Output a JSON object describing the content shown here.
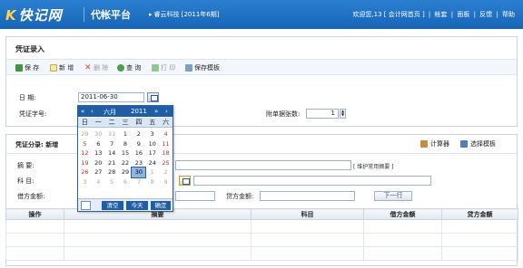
{
  "header": {
    "logo_text": "快记网",
    "logo_mark": "K",
    "platform": "代帐平台",
    "company": "睿云科技  [2011年6期]",
    "nav": [
      "欢迎您,13 [ 会计网首页 ]",
      "|",
      "帐套",
      "|",
      "面板",
      "|",
      "反馈",
      "|",
      "帮助"
    ]
  },
  "voucher": {
    "title": "凭证录入",
    "toolbar": {
      "save": "保 存",
      "add": "新 增",
      "delete": "删 除",
      "query": "查 询",
      "print": "打 印",
      "save_template": "保存模板"
    },
    "date_label": "日  期:",
    "date_value": "2011-06-30",
    "word_label": "凭证字号:",
    "attach_label": "附单据张数:",
    "attach_value": "1"
  },
  "entries": {
    "title": "凭证分录: 新增",
    "calculator": "计算器",
    "select_template": "选择模板",
    "summary_label": "摘  要:",
    "maintain_link": "[ 维护常用摘要 ]",
    "account_label": "科  目:",
    "debit_label": "借方金额:",
    "credit_label": "贷方金额:",
    "next_row": "下一行",
    "columns": [
      "操作",
      "摘要",
      "科目",
      "借方金额",
      "贷方金额"
    ]
  },
  "calendar": {
    "month": "六月",
    "year": "2011",
    "weekdays": [
      "日",
      "一",
      "二",
      "三",
      "四",
      "五",
      "六"
    ],
    "days": [
      "29",
      "30",
      "31",
      "1",
      "2",
      "3",
      "4",
      "5",
      "6",
      "7",
      "8",
      "9",
      "10",
      "11",
      "12",
      "13",
      "14",
      "15",
      "16",
      "17",
      "18",
      "19",
      "20",
      "21",
      "22",
      "23",
      "24",
      "25",
      "26",
      "27",
      "28",
      "29",
      "30",
      "1",
      "2",
      "3",
      "4",
      "5",
      "6",
      "7",
      "8",
      "9"
    ],
    "clear": "清空",
    "today": "今天",
    "ok": "确定"
  },
  "colors": {
    "header": "#1d6ec0",
    "accent": "#1d5ea7",
    "weekend": "#c0302a"
  }
}
